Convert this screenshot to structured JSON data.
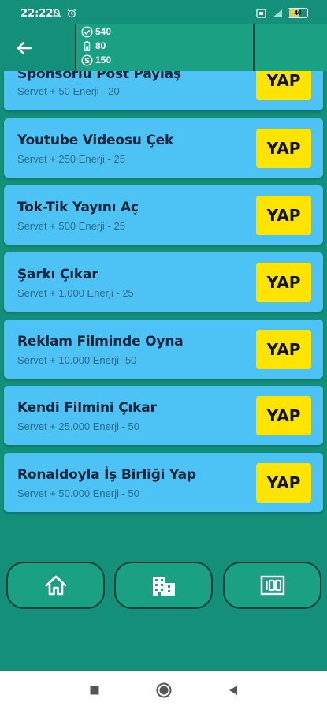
{
  "status": {
    "time": "22:22",
    "battery": "40"
  },
  "stats": {
    "followers": "540",
    "energy": "80",
    "money": "150"
  },
  "tasks": [
    {
      "title": "Sponsorlu Post Paylaş",
      "sub": "Servet + 50   Enerji - 20",
      "button": "YAP"
    },
    {
      "title": "Youtube Videosu Çek",
      "sub": "Servet + 250   Enerji - 25",
      "button": "YAP"
    },
    {
      "title": "Tok-Tik Yayını Aç",
      "sub": "Servet + 500   Enerji - 25",
      "button": "YAP"
    },
    {
      "title": "Şarkı Çıkar",
      "sub": "Servet + 1.000  Enerji - 25",
      "button": "YAP"
    },
    {
      "title": "Reklam Filminde Oyna",
      "sub": "Servet + 10.000  Enerji -50",
      "button": "YAP"
    },
    {
      "title": "Kendi Filmini Çıkar",
      "sub": "Servet + 25.000  Enerji - 50",
      "button": "YAP"
    },
    {
      "title": "Ronaldoyla İş Birliği Yap",
      "sub": "Servet + 50.000  Enerji - 50",
      "button": "YAP"
    }
  ],
  "icons": {
    "back": "arrow-left-icon",
    "home": "home-icon",
    "buildings": "building-icon",
    "score": "100-icon"
  },
  "colors": {
    "background": "#138f7a",
    "card": "#4dc3f5",
    "button": "#ffe400",
    "nav": "#1aa184"
  }
}
